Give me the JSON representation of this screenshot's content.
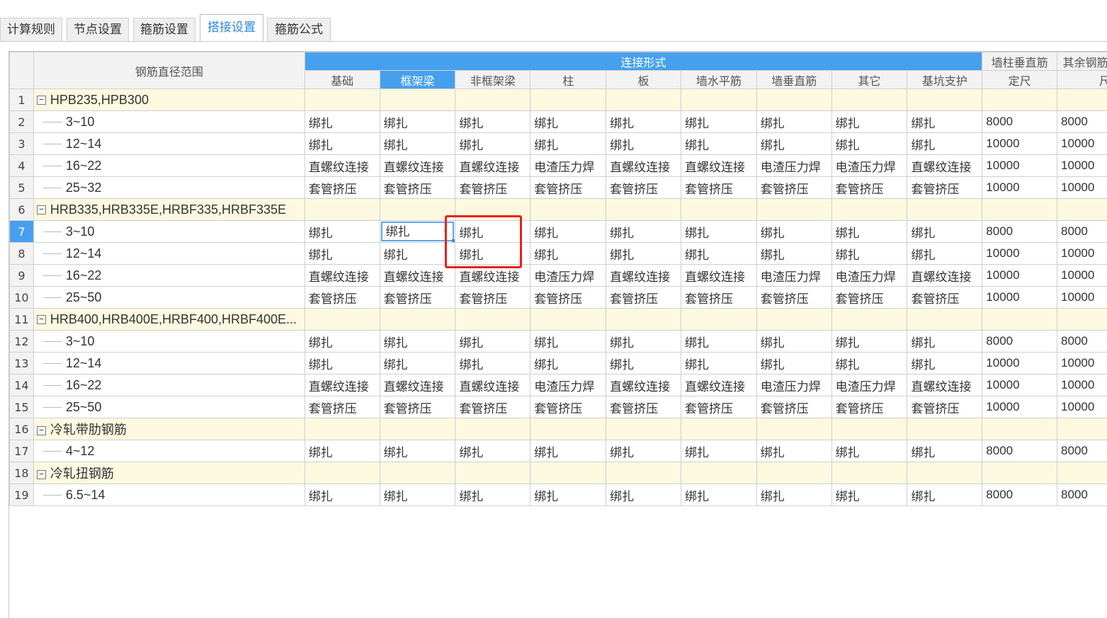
{
  "tabs": [
    {
      "label": "计算规则",
      "active": false
    },
    {
      "label": "节点设置",
      "active": false
    },
    {
      "label": "箍筋设置",
      "active": false
    },
    {
      "label": "搭接设置",
      "active": true
    },
    {
      "label": "箍筋公式",
      "active": false
    }
  ],
  "table": {
    "name_header": "钢筋直径范围",
    "group_header": "连接形式",
    "sub_headers": [
      "基础",
      "框架梁",
      "非框架梁",
      "柱",
      "板",
      "墙水平筋",
      "墙垂直筋",
      "其它",
      "基坑支护"
    ],
    "active_sub_header": "框架梁",
    "extra_headers": [
      {
        "line1": "墙柱垂直筋",
        "line2": "定尺"
      },
      {
        "line1": "其余钢筋",
        "line2": "尺"
      }
    ],
    "rows": [
      {
        "num": "1",
        "group": true,
        "name": "HPB235,HPB300"
      },
      {
        "num": "2",
        "name": "3~10",
        "cells": [
          "绑扎",
          "绑扎",
          "绑扎",
          "绑扎",
          "绑扎",
          "绑扎",
          "绑扎",
          "绑扎",
          "绑扎"
        ],
        "len1": "8000",
        "len2": "8000"
      },
      {
        "num": "3",
        "name": "12~14",
        "cells": [
          "绑扎",
          "绑扎",
          "绑扎",
          "绑扎",
          "绑扎",
          "绑扎",
          "绑扎",
          "绑扎",
          "绑扎"
        ],
        "len1": "10000",
        "len2": "10000"
      },
      {
        "num": "4",
        "name": "16~22",
        "cells": [
          "直螺纹连接",
          "直螺纹连接",
          "直螺纹连接",
          "电渣压力焊",
          "直螺纹连接",
          "直螺纹连接",
          "电渣压力焊",
          "电渣压力焊",
          "直螺纹连接"
        ],
        "len1": "10000",
        "len2": "10000"
      },
      {
        "num": "5",
        "name": "25~32",
        "cells": [
          "套管挤压",
          "套管挤压",
          "套管挤压",
          "套管挤压",
          "套管挤压",
          "套管挤压",
          "套管挤压",
          "套管挤压",
          "套管挤压"
        ],
        "len1": "10000",
        "len2": "10000"
      },
      {
        "num": "6",
        "group": true,
        "name": "HRB335,HRB335E,HRBF335,HRBF335E"
      },
      {
        "num": "7",
        "active": true,
        "name": "3~10",
        "cells": [
          "绑扎",
          "绑扎",
          "绑扎",
          "绑扎",
          "绑扎",
          "绑扎",
          "绑扎",
          "绑扎",
          "绑扎"
        ],
        "len1": "8000",
        "len2": "8000"
      },
      {
        "num": "8",
        "name": "12~14",
        "cells": [
          "绑扎",
          "绑扎",
          "绑扎",
          "绑扎",
          "绑扎",
          "绑扎",
          "绑扎",
          "绑扎",
          "绑扎"
        ],
        "len1": "10000",
        "len2": "10000"
      },
      {
        "num": "9",
        "name": "16~22",
        "cells": [
          "直螺纹连接",
          "直螺纹连接",
          "直螺纹连接",
          "电渣压力焊",
          "直螺纹连接",
          "直螺纹连接",
          "电渣压力焊",
          "电渣压力焊",
          "直螺纹连接"
        ],
        "len1": "10000",
        "len2": "10000"
      },
      {
        "num": "10",
        "name": "25~50",
        "cells": [
          "套管挤压",
          "套管挤压",
          "套管挤压",
          "套管挤压",
          "套管挤压",
          "套管挤压",
          "套管挤压",
          "套管挤压",
          "套管挤压"
        ],
        "len1": "10000",
        "len2": "10000"
      },
      {
        "num": "11",
        "group": true,
        "name": "HRB400,HRB400E,HRBF400,HRBF400E..."
      },
      {
        "num": "12",
        "name": "3~10",
        "cells": [
          "绑扎",
          "绑扎",
          "绑扎",
          "绑扎",
          "绑扎",
          "绑扎",
          "绑扎",
          "绑扎",
          "绑扎"
        ],
        "len1": "8000",
        "len2": "8000"
      },
      {
        "num": "13",
        "name": "12~14",
        "cells": [
          "绑扎",
          "绑扎",
          "绑扎",
          "绑扎",
          "绑扎",
          "绑扎",
          "绑扎",
          "绑扎",
          "绑扎"
        ],
        "len1": "10000",
        "len2": "10000"
      },
      {
        "num": "14",
        "name": "16~22",
        "cells": [
          "直螺纹连接",
          "直螺纹连接",
          "直螺纹连接",
          "电渣压力焊",
          "直螺纹连接",
          "直螺纹连接",
          "电渣压力焊",
          "电渣压力焊",
          "直螺纹连接"
        ],
        "len1": "10000",
        "len2": "10000"
      },
      {
        "num": "15",
        "name": "25~50",
        "cells": [
          "套管挤压",
          "套管挤压",
          "套管挤压",
          "套管挤压",
          "套管挤压",
          "套管挤压",
          "套管挤压",
          "套管挤压",
          "套管挤压"
        ],
        "len1": "10000",
        "len2": "10000"
      },
      {
        "num": "16",
        "group": true,
        "name": "冷轧带肋钢筋"
      },
      {
        "num": "17",
        "name": "4~12",
        "cells": [
          "绑扎",
          "绑扎",
          "绑扎",
          "绑扎",
          "绑扎",
          "绑扎",
          "绑扎",
          "绑扎",
          "绑扎"
        ],
        "len1": "8000",
        "len2": "8000"
      },
      {
        "num": "18",
        "group": true,
        "name": "冷轧扭钢筋"
      },
      {
        "num": "19",
        "name": "6.5~14",
        "cells": [
          "绑扎",
          "绑扎",
          "绑扎",
          "绑扎",
          "绑扎",
          "绑扎",
          "绑扎",
          "绑扎",
          "绑扎"
        ],
        "len1": "8000",
        "len2": "8000"
      }
    ]
  },
  "editor": {
    "row": "7",
    "column": "框架梁",
    "value": "绑扎",
    "dropdown_icon": "chevron-down-icon"
  },
  "colors": {
    "accent": "#46a0ee",
    "active_tab_text": "#2e86de",
    "group_row_bg": "#fdf9e1",
    "highlight_box": "#e8231b"
  }
}
